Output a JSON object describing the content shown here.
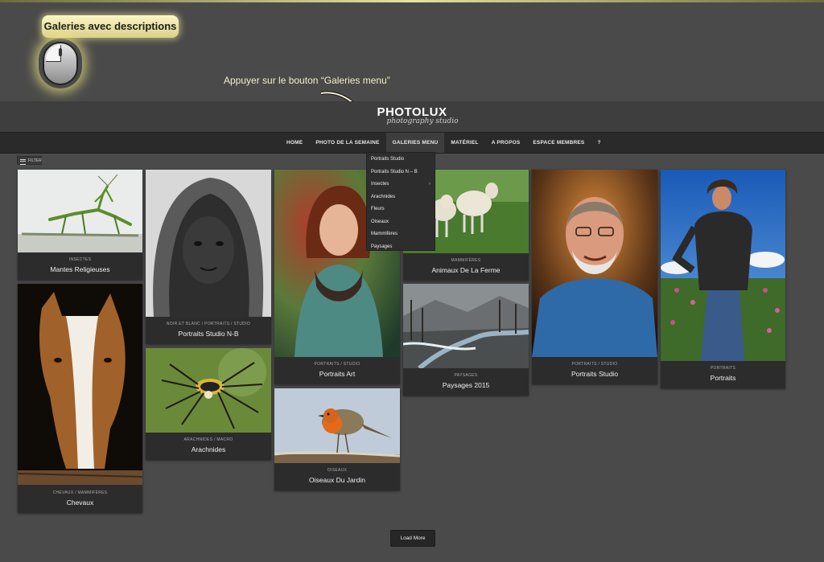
{
  "annotation": {
    "badge": "Galeries avec descriptions",
    "instruction": "Appuyer sur le bouton “Galeries menu”"
  },
  "site": {
    "title": "PHOTOLUX",
    "subtitle": "photography studio"
  },
  "nav": {
    "items": [
      "HOME",
      "PHOTO DE LA SEMAINE",
      "GALERIES MENU",
      "MATÉRIEL",
      "A PROPOS",
      "ESPACE MEMBRES",
      "?"
    ]
  },
  "dropdown": {
    "items": [
      "Portraits Studio",
      "Portraits Studio N – B",
      "Insectes",
      "Arachnides",
      "Fleurs",
      "Oiseaux",
      "Mammifères",
      "Paysages"
    ]
  },
  "filter_label": "FILTER",
  "cards": [
    {
      "category": "INSECTES",
      "title": "Mantes Religieuses"
    },
    {
      "category": "CHEVAUX / MAMMIFÈRES",
      "title": "Chevaux"
    },
    {
      "category": "NOIR ET BLANC / PORTRAITS / STUDIO",
      "title": "Portraits Studio N-B"
    },
    {
      "category": "ARACHNIDES / MACRO",
      "title": "Arachnides"
    },
    {
      "category": "PORTRAITS / STUDIO",
      "title": "Portraits Art"
    },
    {
      "category": "OISEAUX",
      "title": "Oiseaux Du Jardin"
    },
    {
      "category": "MAMMIFÈRES",
      "title": "Animaux De La Ferme"
    },
    {
      "category": "PAYSAGES",
      "title": "Paysages 2015"
    },
    {
      "category": "PORTRAITS / STUDIO",
      "title": "Portraits Studio"
    },
    {
      "category": "PORTRAITS",
      "title": "Portraits"
    }
  ],
  "load_more": "Load More"
}
